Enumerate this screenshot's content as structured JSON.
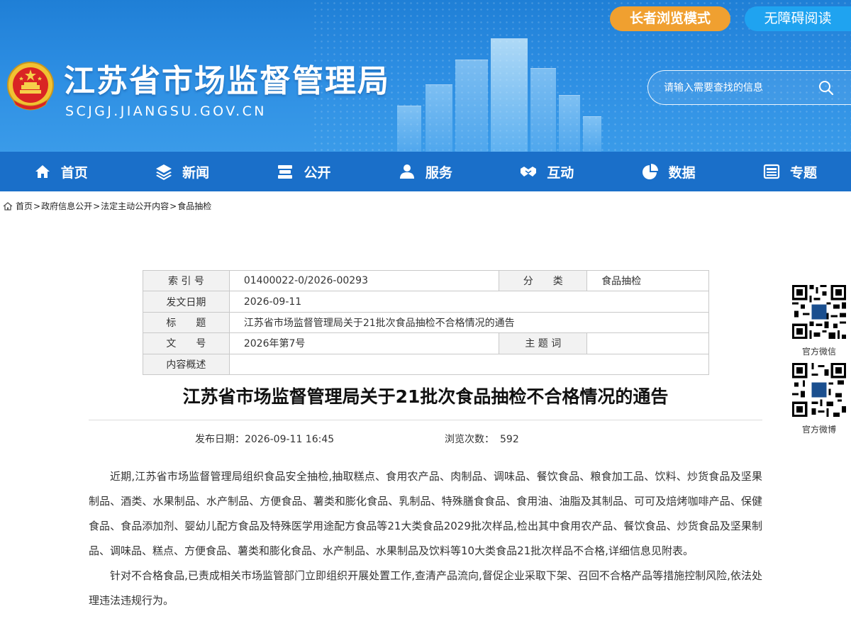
{
  "header": {
    "site_title": "江苏省市场监督管理局",
    "site_domain": "SCJGJ.JIANGSU.GOV.CN",
    "elder_mode_label": "长者浏览模式",
    "accessibility_label": "无障碍阅读",
    "search_placeholder": "请输入需要查找的信息"
  },
  "nav": {
    "items": [
      {
        "label": "首页",
        "icon": "home-icon"
      },
      {
        "label": "新闻",
        "icon": "layers-icon"
      },
      {
        "label": "公开",
        "icon": "stack-icon"
      },
      {
        "label": "服务",
        "icon": "users-icon"
      },
      {
        "label": "互动",
        "icon": "handshake-icon"
      },
      {
        "label": "数据",
        "icon": "pie-chart-icon"
      },
      {
        "label": "专题",
        "icon": "window-icon"
      }
    ]
  },
  "breadcrumb": {
    "items": [
      "首页",
      "政府信息公开",
      "法定主动公开内容",
      "食品抽检"
    ],
    "separator": ">"
  },
  "meta": {
    "index_label": "索 引 号",
    "index_value": "01400022-0/2026-00293",
    "category_label": "分　　类",
    "category_value": "食品抽检",
    "date_label": "发文日期",
    "date_value": "2026-09-11",
    "title_label": "标　　题",
    "title_value": "江苏省市场监督管理局关于21批次食品抽检不合格情况的通告",
    "doc_no_label": "文　　号",
    "doc_no_value": "2026年第7号",
    "keywords_label": "主 题 词",
    "keywords_value": "",
    "summary_label": "内容概述",
    "summary_value": ""
  },
  "article": {
    "title": "江苏省市场监督管理局关于21批次食品抽检不合格情况的通告",
    "pub_date_label": "发布日期：",
    "pub_date_value": "2026-09-11 16:45",
    "views_label": "浏览次数：",
    "views_value": "592",
    "paragraphs": [
      "近期,江苏省市场监督管理局组织食品安全抽检,抽取糕点、食用农产品、肉制品、调味品、餐饮食品、粮食加工品、饮料、炒货食品及坚果制品、酒类、水果制品、水产制品、方便食品、薯类和膨化食品、乳制品、特殊膳食食品、食用油、油脂及其制品、可可及焙烤咖啡产品、保健食品、食品添加剂、婴幼儿配方食品及特殊医学用途配方食品等21大类食品2029批次样品,检出其中食用农产品、餐饮食品、炒货食品及坚果制品、调味品、糕点、方便食品、薯类和膨化食品、水产制品、水果制品及饮料等10大类食品21批次样品不合格,详细信息见附表。",
      "针对不合格食品,已责成相关市场监管部门立即组织开展处置工作,查清产品流向,督促企业采取下架、召回不合格产品等措施控制风险,依法处理违法违规行为。"
    ]
  },
  "side": {
    "wechat_label": "官方微信",
    "weibo_label": "官方微博"
  },
  "colors": {
    "header_blue": "#2c8de2",
    "nav_blue": "#1a6fc9",
    "elder_orange": "#f0a030",
    "access_blue": "#1fa3f0"
  }
}
